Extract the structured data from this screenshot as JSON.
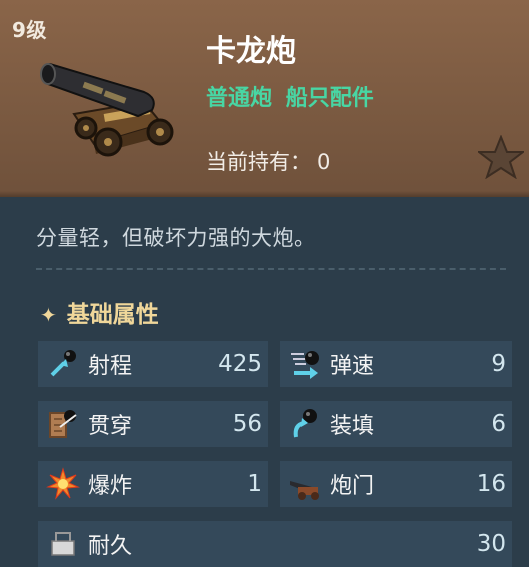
{
  "item": {
    "level": "9级",
    "name": "卡龙炮",
    "tags": [
      "普通炮",
      "船只配件"
    ],
    "holding_label": "当前持有：",
    "holding_count": "0",
    "description": "分量轻，但破坏力强的大炮。",
    "icon": "cannon-icon"
  },
  "section": {
    "title": "基础属性"
  },
  "stats": [
    {
      "label": "射程",
      "value": "425",
      "icon": "range-icon"
    },
    {
      "label": "弹速",
      "value": "9",
      "icon": "projectile-speed-icon"
    },
    {
      "label": "贯穿",
      "value": "56",
      "icon": "penetration-icon"
    },
    {
      "label": "装填",
      "value": "6",
      "icon": "reload-icon"
    },
    {
      "label": "爆炸",
      "value": "1",
      "icon": "explosion-icon"
    },
    {
      "label": "炮门",
      "value": "16",
      "icon": "gunport-icon"
    },
    {
      "label": "耐久",
      "value": "30",
      "icon": "durability-icon"
    }
  ],
  "colors": {
    "accent_green": "#48d6a4",
    "section_gold": "#f0d79a",
    "panel_bg": "#2c3d4a",
    "header_bg": "#7b5a41"
  }
}
